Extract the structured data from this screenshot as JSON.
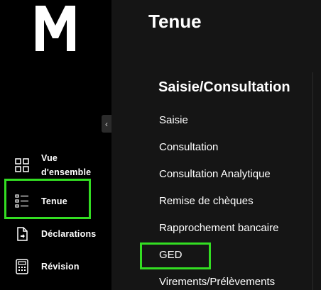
{
  "sidebar": {
    "logo_name": "M-logo",
    "items": [
      {
        "label": "Vue d'ensemble",
        "icon": "grid-icon"
      },
      {
        "label": "Tenue",
        "icon": "list-icon",
        "highlighted": true
      },
      {
        "label": "Déclarations",
        "icon": "document-icon"
      },
      {
        "label": "Révision",
        "icon": "calculator-icon"
      }
    ],
    "collapse_glyph": "‹"
  },
  "main": {
    "title": "Tenue",
    "section_title": "Saisie/Consultation",
    "menu": [
      {
        "label": "Saisie"
      },
      {
        "label": "Consultation"
      },
      {
        "label": "Consultation Analytique"
      },
      {
        "label": "Remise de chèques"
      },
      {
        "label": "Rapprochement bancaire"
      },
      {
        "label": "GED",
        "highlighted": true
      },
      {
        "label": "Virements/Prélèvements"
      }
    ]
  },
  "colors": {
    "highlight": "#33dd22",
    "sidebar_bg": "#000000",
    "main_bg": "#151515"
  }
}
